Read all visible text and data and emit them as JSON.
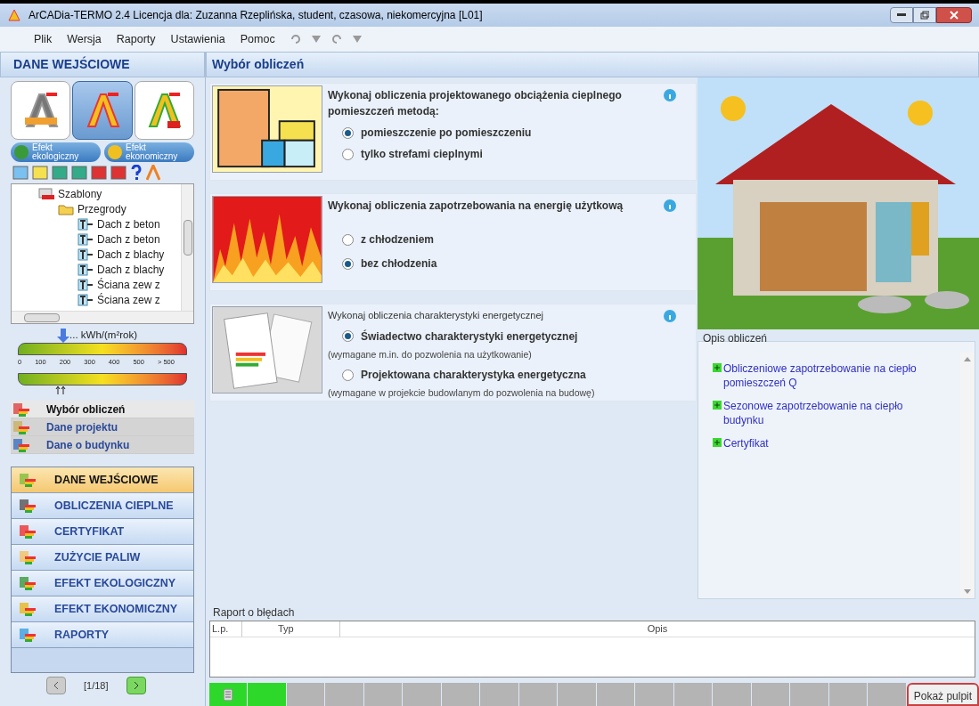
{
  "window": {
    "title": "ArCADia-TERMO 2.4 Licencja dla: Zuzanna Rzeplińska, student, czasowa, niekomercyjna [L01]"
  },
  "menu": [
    "Plik",
    "Wersja",
    "Raporty",
    "Ustawienia",
    "Pomoc"
  ],
  "left_panel": {
    "header": "DANE WEJŚCIOWE",
    "modes": [
      {
        "kind": "basic",
        "selected": false
      },
      {
        "kind": "standard",
        "selected": true
      },
      {
        "kind": "pro",
        "selected": false
      }
    ],
    "effects": [
      {
        "kind": "eco",
        "label": "Efekt ekologiczny"
      },
      {
        "kind": "money",
        "label": "Efekt ekonomiczny"
      }
    ],
    "tree": [
      {
        "label": "Szablony",
        "kind": "templates",
        "children": [
          {
            "label": "Przegrody",
            "kind": "folder",
            "children": [
              {
                "label": "Dach z beton",
                "kind": "layer"
              },
              {
                "label": "Dach z beton",
                "kind": "layer"
              },
              {
                "label": "Dach z blachy",
                "kind": "layer"
              },
              {
                "label": "Dach z blachy",
                "kind": "layer"
              },
              {
                "label": "Ściana zew z",
                "kind": "layer"
              },
              {
                "label": "Ściana zew z",
                "kind": "layer"
              }
            ]
          }
        ]
      }
    ],
    "scale": {
      "unit": "... kWh/(m²rok)",
      "ticks": [
        "0",
        "100",
        "200",
        "300",
        "400",
        "500",
        "> 500"
      ]
    },
    "sub_nav": [
      {
        "label": "Wybór obliczeń",
        "kind": "calc",
        "selected": true
      },
      {
        "label": "Dane projektu",
        "kind": "project",
        "selected": false
      },
      {
        "label": "Dane o budynku",
        "kind": "building",
        "selected": false
      }
    ],
    "nav": [
      {
        "label": "DANE WEJŚCIOWE",
        "kind": "input",
        "selected": true
      },
      {
        "label": "OBLICZENIA CIEPLNE",
        "kind": "heat",
        "selected": false
      },
      {
        "label": "CERTYFIKAT",
        "kind": "cert",
        "selected": false
      },
      {
        "label": "ZUŻYCIE PALIW",
        "kind": "fuel",
        "selected": false
      },
      {
        "label": "EFEKT EKOLOGICZNY",
        "kind": "eco",
        "selected": false
      },
      {
        "label": "EFEKT EKONOMICZNY",
        "kind": "money",
        "selected": false
      },
      {
        "label": "RAPORTY",
        "kind": "reports",
        "selected": false
      }
    ],
    "pager": "[1/18]"
  },
  "main": {
    "header": "Wybór obliczeń",
    "sections": [
      {
        "kind": "plan",
        "title": "Wykonaj obliczenia projektowanego obciążenia cieplnego pomieszczeń metodą:",
        "title_bold": true,
        "options": [
          {
            "label": "pomieszczenie po pomieszczeniu",
            "selected": true
          },
          {
            "label": "tylko strefami cieplnymi",
            "selected": false
          }
        ]
      },
      {
        "kind": "fire",
        "title": "Wykonaj obliczenia zapotrzebowania na energię użytkową",
        "title_bold": true,
        "options": [
          {
            "label": "z chłodzeniem",
            "selected": false
          },
          {
            "label": "bez chłodzenia",
            "selected": true
          }
        ]
      },
      {
        "kind": "docs",
        "title": "Wykonaj obliczenia charakterystyki energetycznej",
        "title_bold": false,
        "options": [
          {
            "label": "Świadectwo charakterystyki energetycznej",
            "note": "(wymagane m.in. do pozwolenia na użytkowanie)",
            "selected": true
          },
          {
            "label": "Projektowana charakterystyka energetyczna",
            "note": "(wymagane w projekcie budowlanym do pozwolenia na budowę)",
            "selected": false
          }
        ]
      }
    ],
    "description": {
      "legend": "Opis obliczeń",
      "links": [
        "Obliczeniowe zapotrzebowanie na ciepło pomieszczeń Q",
        "Sezonowe zapotrzebowanie na ciepło budynku",
        "Certyfikat"
      ]
    },
    "errors": {
      "legend": "Raport o błędach",
      "columns": [
        "L.p.",
        "Typ",
        "Opis"
      ]
    }
  },
  "steps": [
    {
      "done": true
    },
    {
      "done": true
    },
    {
      "done": false
    },
    {
      "done": false
    },
    {
      "done": false
    },
    {
      "done": false
    },
    {
      "done": false
    },
    {
      "done": false
    },
    {
      "done": false
    },
    {
      "done": false
    },
    {
      "done": false
    },
    {
      "done": false
    },
    {
      "done": false
    },
    {
      "done": false
    },
    {
      "done": false
    },
    {
      "done": false
    },
    {
      "done": false
    },
    {
      "done": false
    }
  ],
  "tooltip": "Pokaż pulpit"
}
